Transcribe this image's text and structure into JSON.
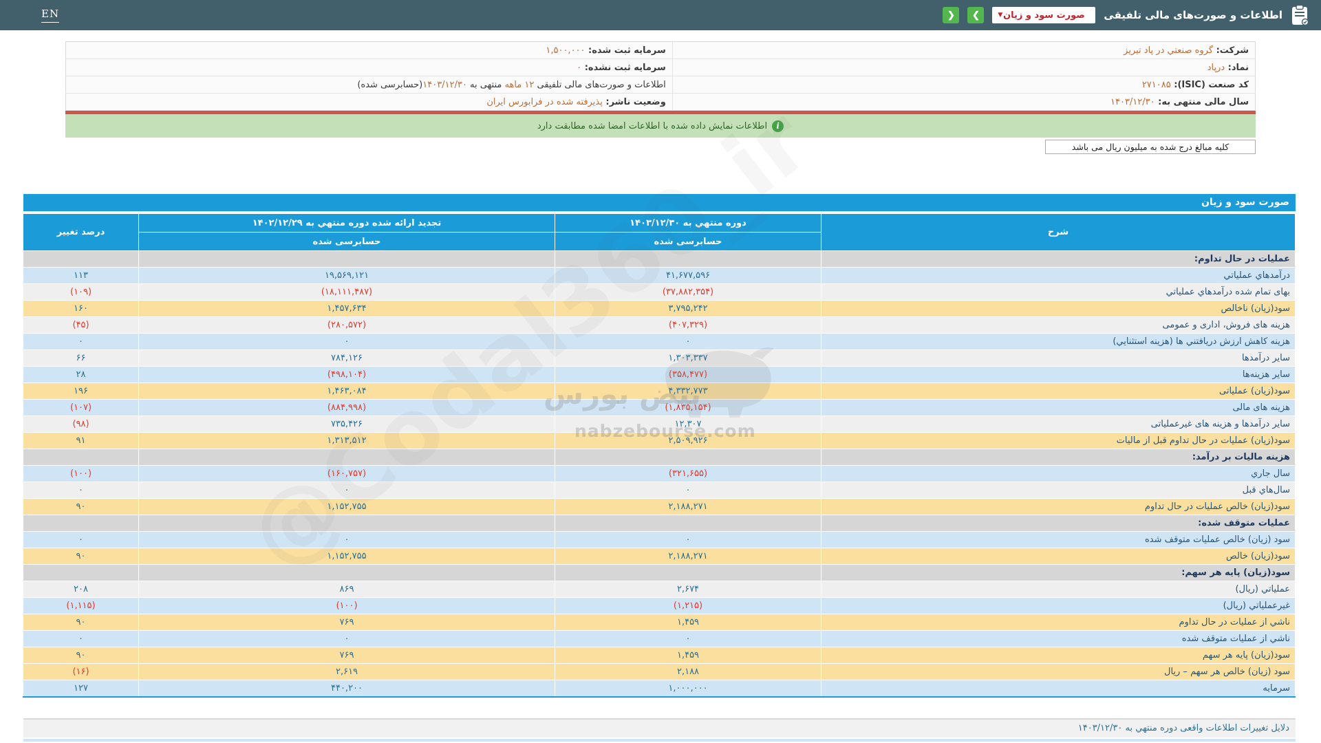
{
  "colors": {
    "topbar": "#42606C",
    "accent_green": "#53B74E",
    "dropdown_text": "#C0272D",
    "table_header": "#1B9CD9",
    "row_yellow": "#FADF9E",
    "row_blue": "#CFE4F4",
    "row_gray": "#D6D6D6",
    "row_white": "#EFEFEF",
    "positive": "#2B6E91",
    "negative": "#DF3B30",
    "value_orange": "#BF6B35",
    "notice_bg": "#C4E0B8",
    "divider_red": "#D0544C"
  },
  "topbar": {
    "en_label": "EN",
    "title": "اطلاعات و صورت‌های مالی تلفیقی",
    "dropdown_value": "صورت سود و زیان",
    "dropdown_caret": "▼",
    "nav_next_glyph": "❯",
    "nav_prev_glyph": "❮"
  },
  "company_info": {
    "rows": [
      {
        "right": [
          {
            "t": "شرکت:  ",
            "k": "l"
          },
          {
            "t": "گروه صنعتي در پاد تبريز",
            "k": "v"
          }
        ],
        "left": [
          {
            "t": "سرمایه ثبت شده:  ",
            "k": "l"
          },
          {
            "t": "۱,۵۰۰,۰۰۰",
            "k": "v"
          }
        ]
      },
      {
        "right": [
          {
            "t": "نماد:  ",
            "k": "l"
          },
          {
            "t": "درپاد",
            "k": "v"
          }
        ],
        "left": [
          {
            "t": "سرمایه ثبت نشده:  ",
            "k": "l"
          },
          {
            "t": "۰",
            "k": "v"
          }
        ]
      },
      {
        "right": [
          {
            "t": "کد صنعت (ISIC):  ",
            "k": "l"
          },
          {
            "t": "۲۷۱۰۸۵",
            "k": "v"
          }
        ],
        "left": [
          {
            "t": "اطلاعات و صورت‌های مالی تلفیقی ",
            "k": "p"
          },
          {
            "t": "۱۲ ماهه",
            "k": "v"
          },
          {
            "t": " منتهی به ",
            "k": "p"
          },
          {
            "t": "۱۴۰۳/۱۲/۳۰",
            "k": "v"
          },
          {
            "t": "(حسابرسی شده)",
            "k": "p"
          }
        ]
      },
      {
        "right": [
          {
            "t": "سال مالی منتهی به:  ",
            "k": "l"
          },
          {
            "t": "۱۴۰۳/۱۲/۳۰",
            "k": "v"
          }
        ],
        "left": [
          {
            "t": "وضعیت ناشر:  ",
            "k": "l"
          },
          {
            "t": "پذیرفته شده در فرابورس ایران",
            "k": "v"
          }
        ]
      }
    ]
  },
  "notice": {
    "text": "اطلاعات نمایش داده شده با اطلاعات امضا شده مطابقت دارد",
    "icon": "i"
  },
  "units_note": "کلیه مبالغ درج شده به میلیون ریال می باشد",
  "statement": {
    "title": "صورت سود و زیان",
    "columns": {
      "desc": "شرح",
      "current_period": "دوره منتهي به ۱۴۰۳/۱۲/۳۰",
      "current_sub": "حسابرسی شده",
      "restated_period": "تجدید ارائه شده دوره منتهي به ۱۴۰۲/۱۲/۲۹",
      "restated_sub": "حسابرسی شده",
      "pct_change": "درصد تغییر"
    },
    "rows": [
      {
        "type": "group",
        "label": "عملیات در حال تداوم:"
      },
      {
        "bg": "b",
        "label": "درآمدهاي عملياتي",
        "current": "۴۱,۶۷۷,۵۹۶",
        "prior": "۱۹,۵۶۹,۱۲۱",
        "pct": "۱۱۳"
      },
      {
        "bg": "w",
        "label": "بهای تمام شده درآمدهاي عملياتي",
        "current": "(۳۷,۸۸۲,۳۵۴)",
        "prior": "(۱۸,۱۱۱,۴۸۷)",
        "pct": "(۱۰۹)"
      },
      {
        "bg": "y",
        "label": "سود(زیان) ناخالص",
        "current": "۳,۷۹۵,۲۴۲",
        "prior": "۱,۴۵۷,۶۳۴",
        "pct": "۱۶۰"
      },
      {
        "bg": "w",
        "label": "هزینه های فروش، اداری و عمومی",
        "current": "(۴۰۷,۳۲۹)",
        "prior": "(۲۸۰,۵۷۲)",
        "pct": "(۴۵)"
      },
      {
        "bg": "b",
        "label": "هزینه کاهش ارزش دریافتني ها (هزینه استثنایي)",
        "current": "۰",
        "prior": "۰",
        "pct": "۰"
      },
      {
        "bg": "w",
        "label": "سایر درآمدها",
        "current": "۱,۳۰۳,۳۳۷",
        "prior": "۷۸۴,۱۲۶",
        "pct": "۶۶"
      },
      {
        "bg": "b",
        "label": "سایر هزینه‌ها",
        "current": "(۳۵۸,۴۷۷)",
        "prior": "(۴۹۸,۱۰۴)",
        "pct": "۲۸"
      },
      {
        "bg": "y",
        "label": "سود(زیان) عملیاتی",
        "current": "۴,۳۳۲,۷۷۳",
        "prior": "۱,۴۶۳,۰۸۴",
        "pct": "۱۹۶"
      },
      {
        "bg": "b",
        "label": "هزینه های مالی",
        "current": "(۱,۸۳۵,۱۵۴)",
        "prior": "(۸۸۴,۹۹۸)",
        "pct": "(۱۰۷)"
      },
      {
        "bg": "w",
        "label": "سایر درآمدها و هزینه های غیرعملیاتی",
        "current": "۱۲,۳۰۷",
        "prior": "۷۳۵,۴۲۶",
        "pct": "(۹۸)"
      },
      {
        "bg": "y",
        "label": "سود(زیان) عملیات در حال تداوم قبل از مالیات",
        "current": "۲,۵۰۹,۹۲۶",
        "prior": "۱,۳۱۳,۵۱۲",
        "pct": "۹۱"
      },
      {
        "type": "group",
        "label": "هزینه مالیات بر درآمد:"
      },
      {
        "bg": "b",
        "label": "سال جاري",
        "current": "(۳۲۱,۶۵۵)",
        "prior": "(۱۶۰,۷۵۷)",
        "pct": "(۱۰۰)"
      },
      {
        "bg": "w",
        "label": "سال‌هاي قبل",
        "current": "۰",
        "prior": "۰",
        "pct": "۰"
      },
      {
        "bg": "y",
        "label": "سود(زیان) خالص عملیات در حال تداوم",
        "current": "۲,۱۸۸,۲۷۱",
        "prior": "۱,۱۵۲,۷۵۵",
        "pct": "۹۰"
      },
      {
        "type": "group",
        "label": "عملیات متوقف شده:"
      },
      {
        "bg": "b",
        "label": "سود (زیان) خالص عملیات متوقف شده",
        "current": "۰",
        "prior": "۰",
        "pct": "۰"
      },
      {
        "bg": "y",
        "label": "سود(زیان) خالص",
        "current": "۲,۱۸۸,۲۷۱",
        "prior": "۱,۱۵۲,۷۵۵",
        "pct": "۹۰"
      },
      {
        "type": "group",
        "label": "سود(زیان) پایه هر سهم:"
      },
      {
        "bg": "w",
        "label": "عملياتي (ریال)",
        "current": "۲,۶۷۴",
        "prior": "۸۶۹",
        "pct": "۲۰۸"
      },
      {
        "bg": "b",
        "label": "غیرعملیاتي (ریال)",
        "current": "(۱,۲۱۵)",
        "prior": "(۱۰۰)",
        "pct": "(۱,۱۱۵)"
      },
      {
        "bg": "y",
        "label": "ناشي از عملیات در حال تداوم",
        "current": "۱,۴۵۹",
        "prior": "۷۶۹",
        "pct": "۹۰"
      },
      {
        "bg": "b",
        "label": "ناشي از عملیات متوقف شده",
        "current": "۰",
        "prior": "۰",
        "pct": "۰"
      },
      {
        "bg": "y",
        "label": "سود(زیان) پایه هر سهم",
        "current": "۱,۴۵۹",
        "prior": "۷۶۹",
        "pct": "۹۰"
      },
      {
        "bg": "y",
        "label": "سود (زیان) خالص هر سهم – ریال",
        "current": "۲,۱۸۸",
        "prior": "۲,۶۱۹",
        "pct": "(۱۶)"
      },
      {
        "bg": "b",
        "label": "سرمایه",
        "current": "۱,۰۰۰,۰۰۰",
        "prior": "۴۴۰,۲۰۰",
        "pct": "۱۲۷"
      }
    ]
  },
  "footer": {
    "section_title": "دلایل تغییرات اطلاعات واقعی دوره منتهي به ۱۴۰۳/۱۲/۳۰"
  },
  "watermark": {
    "diagonal": "@Codal360_ir",
    "brand_fa": "نبض بورس",
    "brand_url": "nabzebourse.com"
  }
}
